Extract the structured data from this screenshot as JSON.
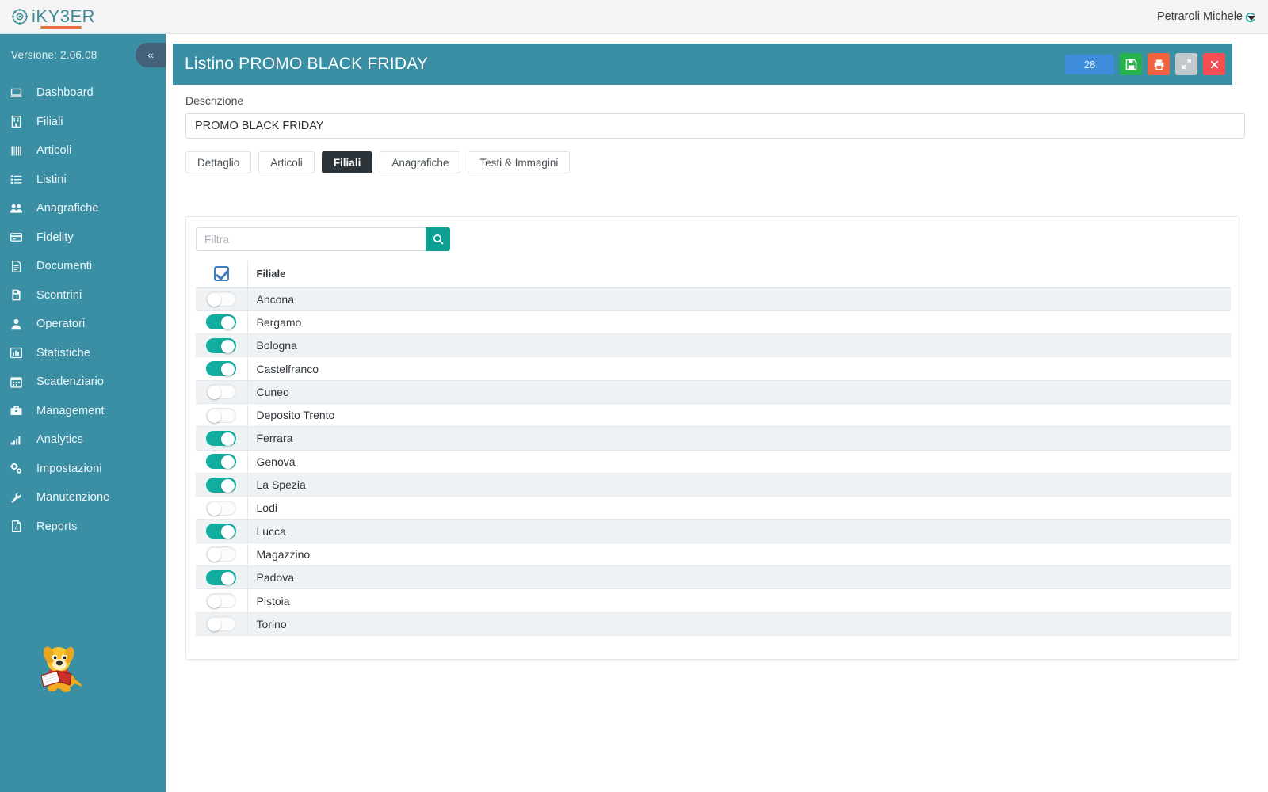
{
  "topbar": {
    "logo_i": "i",
    "logo_name": "KY3ER",
    "logo_icon": "compass-wheel-icon",
    "user_name": "Petraroli Michele"
  },
  "sidebar": {
    "version_label": "Versione: 2.06.08",
    "collapse_icon": "«",
    "items": [
      {
        "label": "Dashboard",
        "icon": "laptop-icon"
      },
      {
        "label": "Filiali",
        "icon": "building-icon"
      },
      {
        "label": "Articoli",
        "icon": "barcode-icon"
      },
      {
        "label": "Listini",
        "icon": "list-icon"
      },
      {
        "label": "Anagrafiche",
        "icon": "users-icon"
      },
      {
        "label": "Fidelity",
        "icon": "credit-card-icon"
      },
      {
        "label": "Documenti",
        "icon": "file-text-icon"
      },
      {
        "label": "Scontrini",
        "icon": "receipt-printer-icon"
      },
      {
        "label": "Operatori",
        "icon": "user-icon"
      },
      {
        "label": "Statistiche",
        "icon": "bar-chart-icon"
      },
      {
        "label": "Scadenziario",
        "icon": "calendar-icon"
      },
      {
        "label": "Management",
        "icon": "briefcase-icon"
      },
      {
        "label": "Analytics",
        "icon": "signal-bars-icon"
      },
      {
        "label": "Impostazioni",
        "icon": "gears-icon"
      },
      {
        "label": "Manutenzione",
        "icon": "wrench-icon"
      },
      {
        "label": "Reports",
        "icon": "pdf-file-icon"
      }
    ],
    "mascot_icon": "dog-reading-book-icon"
  },
  "panel": {
    "title": "Listino PROMO BLACK FRIDAY",
    "badge_count": "28",
    "buttons": [
      {
        "name": "save-button",
        "icon": "floppy-disk-icon",
        "color": "#27b34b"
      },
      {
        "name": "print-button",
        "icon": "printer-icon",
        "color": "#f1633c"
      },
      {
        "name": "expand-button",
        "icon": "expand-arrows-icon",
        "color": "#c2c9cc"
      },
      {
        "name": "close-button",
        "icon": "x-icon",
        "color": "#f54e52"
      }
    ]
  },
  "form": {
    "descrizione_label": "Descrizione",
    "descrizione_value": "PROMO BLACK FRIDAY",
    "descrizione_placeholder": "Descrizione"
  },
  "tabs": [
    {
      "label": "Dettaglio",
      "active": false
    },
    {
      "label": "Articoli",
      "active": false
    },
    {
      "label": "Filiali",
      "active": true
    },
    {
      "label": "Anagrafiche",
      "active": false
    },
    {
      "label": "Testi & Immagini",
      "active": false
    }
  ],
  "filter": {
    "placeholder": "Filtra",
    "value": "",
    "search_icon": "magnifier-icon"
  },
  "table": {
    "select_all_checked": true,
    "columns": [
      "",
      "Filiale"
    ],
    "rows": [
      {
        "name": "Ancona",
        "enabled": false
      },
      {
        "name": "Bergamo",
        "enabled": true
      },
      {
        "name": "Bologna",
        "enabled": true
      },
      {
        "name": "Castelfranco",
        "enabled": true
      },
      {
        "name": "Cuneo",
        "enabled": false
      },
      {
        "name": "Deposito Trento",
        "enabled": false
      },
      {
        "name": "Ferrara",
        "enabled": true
      },
      {
        "name": "Genova",
        "enabled": true
      },
      {
        "name": "La Spezia",
        "enabled": true
      },
      {
        "name": "Lodi",
        "enabled": false
      },
      {
        "name": "Lucca",
        "enabled": true
      },
      {
        "name": "Magazzino",
        "enabled": false
      },
      {
        "name": "Padova",
        "enabled": true
      },
      {
        "name": "Pistoia",
        "enabled": false
      },
      {
        "name": "Torino",
        "enabled": false
      }
    ]
  },
  "colors": {
    "brand_teal": "#3a8fa5",
    "toggle_on": "#12ad9e",
    "accent_orange": "#e8703a",
    "badge_blue": "#3d8ddb",
    "tab_active": "#2b3238"
  }
}
